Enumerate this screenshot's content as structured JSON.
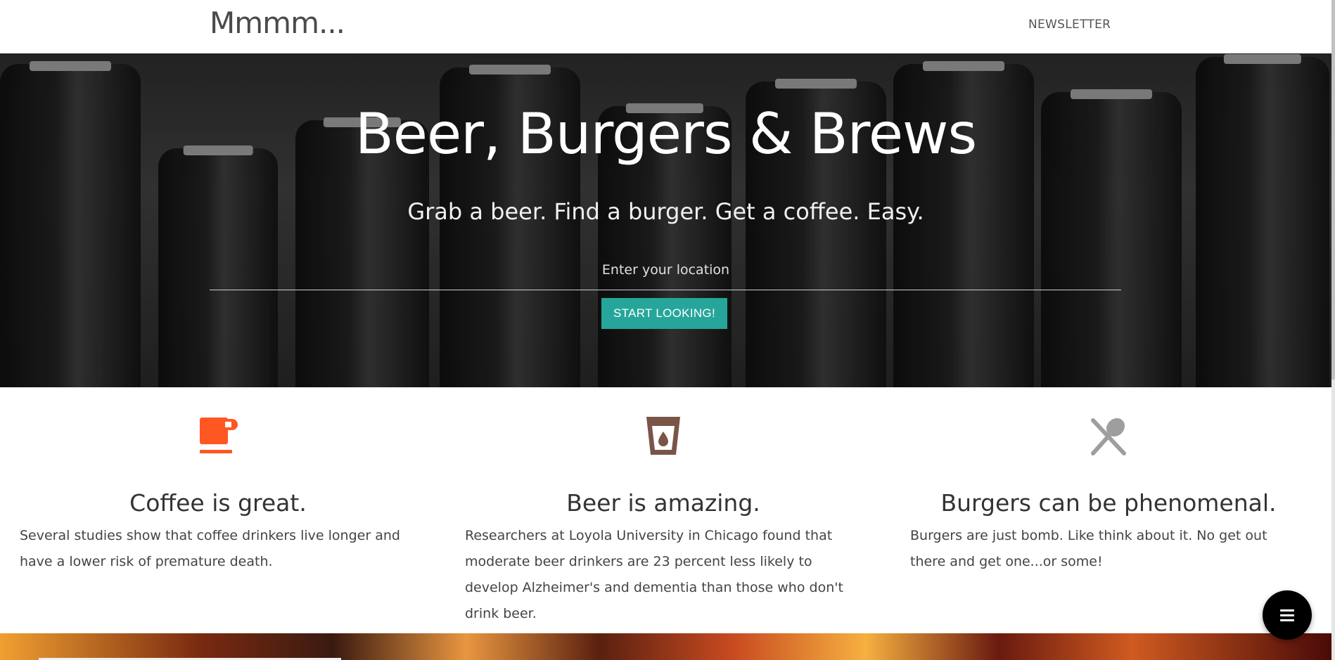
{
  "header": {
    "brand": "Mmmm...",
    "nav_newsletter": "NEWSLETTER"
  },
  "hero": {
    "title": "Beer, Burgers & Brews",
    "subtitle": "Grab a beer. Find a burger. Get a coffee. Easy.",
    "location_label": "Enter your location",
    "location_value": "",
    "cta_label": "START LOOKING!"
  },
  "features": [
    {
      "icon": "coffee-cup-icon",
      "color": "#ff5722",
      "title": "Coffee is great.",
      "text": "Several studies show that coffee drinkers live longer and have a lower risk of premature death."
    },
    {
      "icon": "beer-glass-icon",
      "color": "#795548",
      "title": "Beer is amazing.",
      "text": "Researchers at Loyola University in Chicago found that moderate beer drinkers are 23 percent less likely to develop Alzheimer's and dementia than those who don't drink beer."
    },
    {
      "icon": "restaurant-icon",
      "color": "#9e9e9e",
      "title": "Burgers can be phenomenal.",
      "text": "Burgers are just bomb. Like think about it. No get out there and get one...or some!"
    }
  ],
  "fab": {
    "icon": "menu-icon"
  },
  "colors": {
    "accent": "#26a69a",
    "coffee": "#ff5722",
    "beer": "#795548",
    "food": "#9e9e9e"
  }
}
